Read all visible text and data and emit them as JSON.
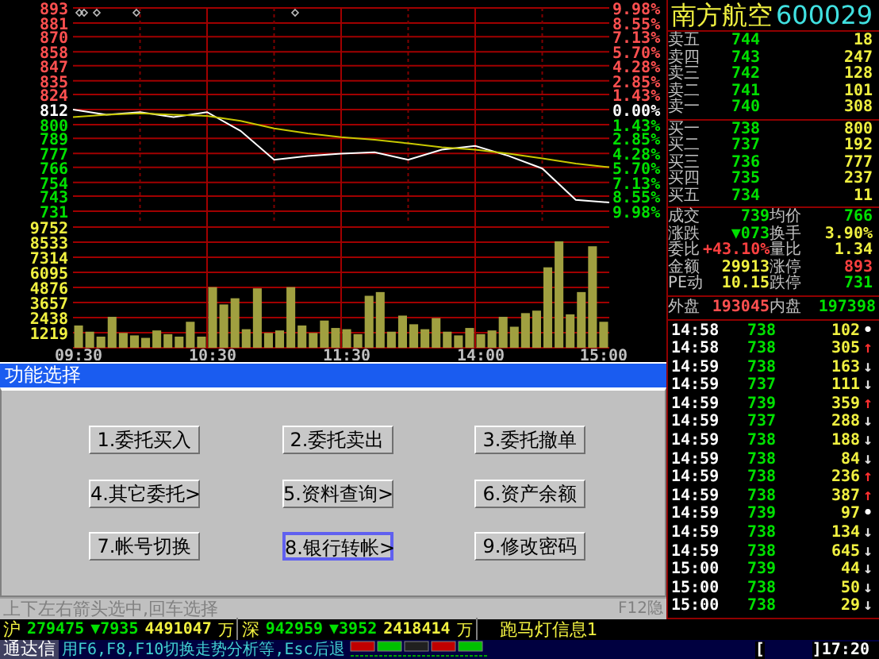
{
  "price_chart": {
    "chart_data": {
      "type": "line",
      "series": [
        {
          "color": "#ffffff",
          "values": [
            812,
            808,
            810,
            806,
            810,
            795,
            772,
            775,
            777,
            778,
            772,
            780,
            783,
            775,
            765,
            740,
            738
          ]
        },
        {
          "color": "#c8c800",
          "values": [
            806,
            808,
            809,
            808,
            807,
            803,
            797,
            793,
            790,
            788,
            785,
            782,
            780,
            777,
            773,
            769,
            766
          ]
        }
      ],
      "grid": true,
      "ylim": [
        731,
        893
      ],
      "yticks": [
        {
          "value": 893,
          "label": "893"
        },
        {
          "value": 881,
          "label": "881"
        },
        {
          "value": 870,
          "label": "870"
        },
        {
          "value": 858,
          "label": "858"
        },
        {
          "value": 847,
          "label": "847"
        },
        {
          "value": 835,
          "label": "835"
        },
        {
          "value": 824,
          "label": "824"
        },
        {
          "value": 812,
          "label": "812"
        },
        {
          "value": 800,
          "label": "800"
        },
        {
          "value": 789,
          "label": "789"
        },
        {
          "value": 777,
          "label": "777"
        },
        {
          "value": 766,
          "label": "766"
        },
        {
          "value": 754,
          "label": "754"
        },
        {
          "value": 743,
          "label": "743"
        },
        {
          "value": 731,
          "label": "731"
        }
      ]
    },
    "percent_axis": [
      {
        "label": "9.98%",
        "kind": "up"
      },
      {
        "label": "8.55%",
        "kind": "up"
      },
      {
        "label": "7.13%",
        "kind": "up"
      },
      {
        "label": "5.70%",
        "kind": "up"
      },
      {
        "label": "4.28%",
        "kind": "up"
      },
      {
        "label": "2.85%",
        "kind": "up"
      },
      {
        "label": "1.43%",
        "kind": "up"
      },
      {
        "label": "0.00%",
        "kind": "flat"
      },
      {
        "label": "1.43%",
        "kind": "down"
      },
      {
        "label": "2.85%",
        "kind": "down"
      },
      {
        "label": "4.28%",
        "kind": "down"
      },
      {
        "label": "5.70%",
        "kind": "down"
      },
      {
        "label": "7.13%",
        "kind": "down"
      },
      {
        "label": "8.55%",
        "kind": "down"
      },
      {
        "label": "9.98%",
        "kind": "down"
      }
    ]
  },
  "volume_chart": {
    "chart_data": {
      "type": "bar",
      "categories": [
        "09:30",
        null,
        null,
        null,
        null,
        null,
        null,
        null,
        null,
        null,
        null,
        null,
        "10:30",
        null,
        null,
        null,
        null,
        null,
        null,
        null,
        null,
        null,
        null,
        null,
        "11:30",
        null,
        null,
        null,
        null,
        null,
        null,
        null,
        null,
        null,
        null,
        null,
        "14:00",
        null,
        null,
        null,
        null,
        null,
        null,
        null,
        null,
        null,
        null,
        "15:00"
      ],
      "values": [
        1800,
        1300,
        900,
        2500,
        1200,
        1000,
        800,
        1400,
        1100,
        900,
        2100,
        900,
        4900,
        3500,
        4000,
        1500,
        4800,
        1200,
        1400,
        4900,
        1800,
        1200,
        2200,
        1600,
        1500,
        1100,
        4200,
        4500,
        1300,
        2600,
        1900,
        1500,
        2400,
        1300,
        1000,
        1600,
        1100,
        1400,
        2500,
        1700,
        2800,
        3000,
        6500,
        8600,
        2700,
        4500,
        8200,
        2100
      ],
      "grid": true,
      "ylim": [
        0,
        9752
      ],
      "yticks": [
        {
          "value": 9752,
          "label": "9752"
        },
        {
          "value": 8533,
          "label": "8533"
        },
        {
          "value": 7314,
          "label": "7314"
        },
        {
          "value": 6095,
          "label": "6095"
        },
        {
          "value": 4876,
          "label": "4876"
        },
        {
          "value": 3657,
          "label": "3657"
        },
        {
          "value": 2438,
          "label": "2438"
        },
        {
          "value": 1219,
          "label": "1219"
        }
      ]
    }
  },
  "dialog": {
    "title": "功能选择",
    "buttons": [
      {
        "label": "1.委托买入",
        "selected": false
      },
      {
        "label": "2.委托卖出",
        "selected": false
      },
      {
        "label": "3.委托撤单",
        "selected": false
      },
      {
        "label": "4.其它委托>",
        "selected": false
      },
      {
        "label": "5.资料查询>",
        "selected": false
      },
      {
        "label": "6.资产余额",
        "selected": false
      },
      {
        "label": "7.帐号切换",
        "selected": false
      },
      {
        "label": "8.银行转帐>",
        "selected": true
      },
      {
        "label": "9.修改密码",
        "selected": false
      }
    ],
    "hint": "上下左右箭头选中,回车选择",
    "shortcut": "F12隐"
  },
  "quote": {
    "name": "南方航空",
    "code": "600029",
    "sell": [
      {
        "label": "卖五",
        "price": "744",
        "volume": "18"
      },
      {
        "label": "卖四",
        "price": "743",
        "volume": "247"
      },
      {
        "label": "卖三",
        "price": "742",
        "volume": "128"
      },
      {
        "label": "卖二",
        "price": "741",
        "volume": "101"
      },
      {
        "label": "卖一",
        "price": "740",
        "volume": "308"
      }
    ],
    "buy": [
      {
        "label": "买一",
        "price": "738",
        "volume": "800"
      },
      {
        "label": "买二",
        "price": "737",
        "volume": "192"
      },
      {
        "label": "买三",
        "price": "736",
        "volume": "777"
      },
      {
        "label": "买四",
        "price": "735",
        "volume": "237"
      },
      {
        "label": "买五",
        "price": "734",
        "volume": "11"
      }
    ],
    "stats": [
      [
        {
          "label": "成交",
          "value": "739",
          "color": "#00e000"
        },
        {
          "label": "均价",
          "value": "766",
          "color": "#00e000"
        }
      ],
      [
        {
          "label": "涨跌",
          "value": "▼073",
          "color": "#00e000"
        },
        {
          "label": "换手",
          "value": "3.90%",
          "color": "#f0f040"
        }
      ],
      [
        {
          "label": "委比",
          "value": "+43.10%",
          "color": "#ff4040"
        },
        {
          "label": "量比",
          "value": "1.34",
          "color": "#f0f040"
        }
      ],
      [
        {
          "label": "金额",
          "value": "29913",
          "color": "#f0f040"
        },
        {
          "label": "涨停",
          "value": "893",
          "color": "#ff4040"
        }
      ],
      [
        {
          "label": "PE动",
          "value": "10.15",
          "color": "#f0f040"
        },
        {
          "label": "跌停",
          "value": "731",
          "color": "#00e000"
        }
      ]
    ],
    "outer_label": "外盘",
    "outer_value": "193045",
    "inner_label": "内盘",
    "inner_value": "197398",
    "ticks": [
      {
        "time": "14:58",
        "price": "738",
        "volume": "102",
        "arrow": "•",
        "kind": "flat"
      },
      {
        "time": "14:58",
        "price": "738",
        "volume": "305",
        "arrow": "↑",
        "kind": "up"
      },
      {
        "time": "14:59",
        "price": "738",
        "volume": "163",
        "arrow": "↓",
        "kind": "down"
      },
      {
        "time": "14:59",
        "price": "737",
        "volume": "111",
        "arrow": "↓",
        "kind": "down"
      },
      {
        "time": "14:59",
        "price": "739",
        "volume": "359",
        "arrow": "↑",
        "kind": "up"
      },
      {
        "time": "14:59",
        "price": "737",
        "volume": "288",
        "arrow": "↓",
        "kind": "down"
      },
      {
        "time": "14:59",
        "price": "738",
        "volume": "188",
        "arrow": "↓",
        "kind": "down"
      },
      {
        "time": "14:59",
        "price": "738",
        "volume": "84",
        "arrow": "↓",
        "kind": "down"
      },
      {
        "time": "14:59",
        "price": "738",
        "volume": "236",
        "arrow": "↑",
        "kind": "up"
      },
      {
        "time": "14:59",
        "price": "738",
        "volume": "387",
        "arrow": "↑",
        "kind": "up"
      },
      {
        "time": "14:59",
        "price": "739",
        "volume": "97",
        "arrow": "•",
        "kind": "flat"
      },
      {
        "time": "14:59",
        "price": "738",
        "volume": "134",
        "arrow": "↓",
        "kind": "down"
      },
      {
        "time": "14:59",
        "price": "738",
        "volume": "645",
        "arrow": "↓",
        "kind": "down"
      },
      {
        "time": "15:00",
        "price": "739",
        "volume": "44",
        "arrow": "↓",
        "kind": "down"
      },
      {
        "time": "15:00",
        "price": "738",
        "volume": "50",
        "arrow": "↓",
        "kind": "down"
      },
      {
        "time": "15:00",
        "price": "738",
        "volume": "29",
        "arrow": "↓",
        "kind": "down"
      }
    ]
  },
  "ticker": {
    "markets": [
      {
        "name": "沪",
        "index": "279475",
        "change": "▼7935",
        "amount": "4491047",
        "unit": "万"
      },
      {
        "name": "深",
        "index": "942959",
        "change": "▼3952",
        "amount": "2418414",
        "unit": "万"
      }
    ],
    "marquee": "跑马灯信息1"
  },
  "status_bar": {
    "brand": "通达信",
    "hint": "用F6,F8,F10切换走势分析等,Esc后退",
    "bracket_open": "[",
    "bracket_close": "]",
    "time": "17:20"
  }
}
